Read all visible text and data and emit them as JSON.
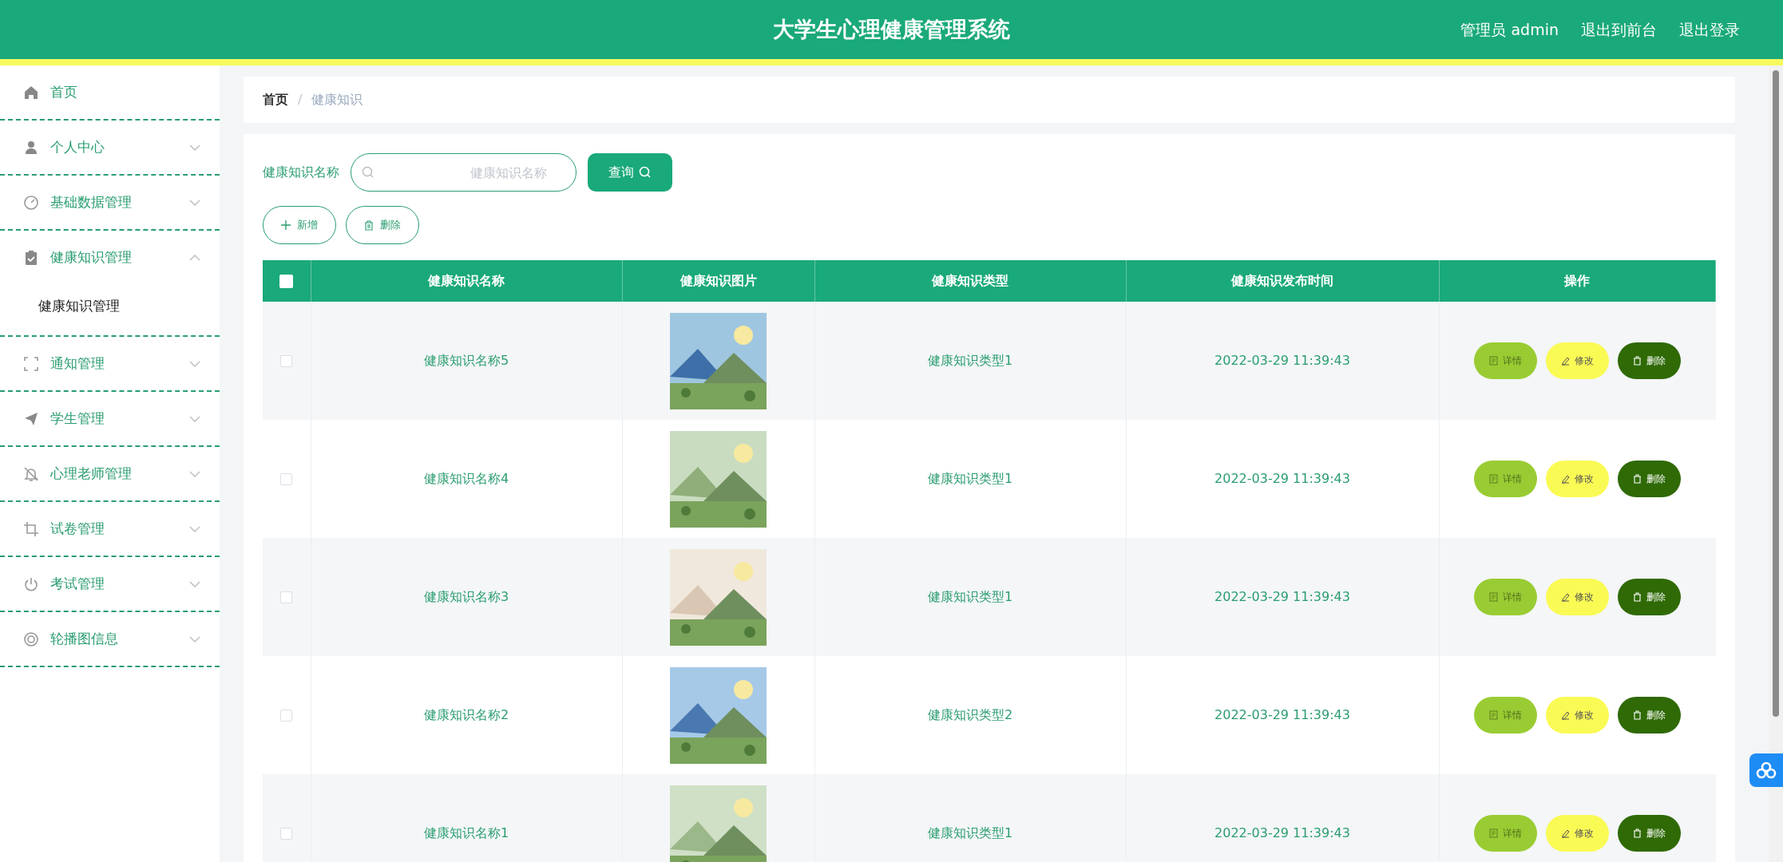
{
  "header": {
    "title": "大学生心理健康管理系统",
    "links": [
      "管理员 admin",
      "退出到前台",
      "退出登录"
    ]
  },
  "sidebar": {
    "items": [
      {
        "label": "首页",
        "kind": "link"
      },
      {
        "label": "个人中心",
        "kind": "menu",
        "expanded": false
      },
      {
        "label": "基础数据管理",
        "kind": "menu",
        "expanded": false
      },
      {
        "label": "健康知识管理",
        "kind": "menu",
        "expanded": true,
        "children": [
          {
            "label": "健康知识管理"
          }
        ]
      },
      {
        "label": "通知管理",
        "kind": "menu",
        "expanded": false
      },
      {
        "label": "学生管理",
        "kind": "menu",
        "expanded": false
      },
      {
        "label": "心理老师管理",
        "kind": "menu",
        "expanded": false
      },
      {
        "label": "试卷管理",
        "kind": "menu",
        "expanded": false
      },
      {
        "label": "考试管理",
        "kind": "menu",
        "expanded": false
      },
      {
        "label": "轮播图信息",
        "kind": "menu",
        "expanded": false
      }
    ]
  },
  "breadcrumb": [
    "首页",
    "/",
    "健康知识"
  ],
  "search": {
    "label": "健康知识名称",
    "placeholder": "健康知识名称",
    "button": "查询"
  },
  "toolbar": [
    "新增",
    "删除"
  ],
  "table": {
    "header_checked": false,
    "columns": [
      "健康知识名称",
      "健康知识图片",
      "健康知识类型",
      "健康知识发布时间",
      "操作"
    ],
    "rows": [
      {
        "checked": false,
        "name": "健康知识名称5",
        "type": "健康知识类型1",
        "time": "2022-03-29 11:39:43",
        "actions": [
          "详情",
          "修改",
          "删除"
        ]
      },
      {
        "checked": false,
        "name": "健康知识名称4",
        "type": "健康知识类型1",
        "time": "2022-03-29 11:39:43",
        "actions": [
          "详情",
          "修改",
          "删除"
        ]
      },
      {
        "checked": false,
        "name": "健康知识名称3",
        "type": "健康知识类型1",
        "time": "2022-03-29 11:39:43",
        "actions": [
          "详情",
          "修改",
          "删除"
        ]
      },
      {
        "checked": false,
        "name": "健康知识名称2",
        "type": "健康知识类型2",
        "time": "2022-03-29 11:39:43",
        "actions": [
          "详情",
          "修改",
          "删除"
        ]
      },
      {
        "checked": false,
        "name": "健康知识名称1",
        "type": "健康知识类型1",
        "time": "2022-03-29 11:39:43",
        "actions": [
          "详情",
          "修改",
          "删除"
        ]
      }
    ]
  }
}
